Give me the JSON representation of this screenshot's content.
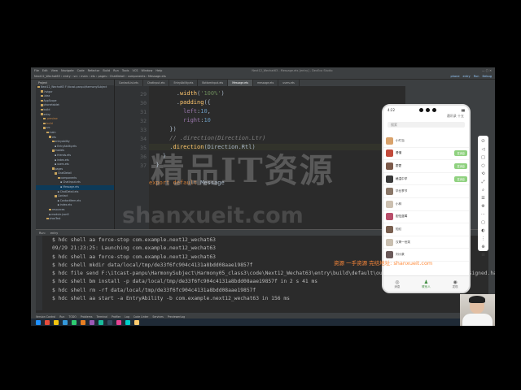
{
  "window": {
    "title": "Next12_Wechat63 - Message.ets [entry] - DevEco Studio",
    "menu": [
      "File",
      "Edit",
      "View",
      "Navigate",
      "Code",
      "Refactor",
      "Build",
      "Run",
      "Tools",
      "VCS",
      "Window",
      "Help"
    ],
    "breadcrumb": [
      "Next12_Wechat63",
      "entry",
      "src",
      "main",
      "ets",
      "pages",
      "ChatDetail",
      "components",
      "Message.ets"
    ],
    "top_right": [
      "phone",
      "entry",
      "Run",
      "Debug"
    ]
  },
  "project_panel": {
    "header": "Project",
    "items": [
      {
        "label": "Next12_Wechat63 F:\\itcast-panpu\\HarmonySubject",
        "folder": true
      },
      {
        "label": ".hvigor",
        "folder": true
      },
      {
        "label": ".idea",
        "folder": true
      },
      {
        "label": "AppScope",
        "folder": true
      },
      {
        "label": "phonetablet",
        "folder": true
      },
      {
        "label": "build",
        "folder": true
      },
      {
        "label": "entry",
        "folder": true
      },
      {
        "label": ".preview",
        "folder": true
      },
      {
        "label": "build",
        "folder": true
      },
      {
        "label": "src",
        "folder": true
      },
      {
        "label": "main",
        "folder": true
      },
      {
        "label": "ets",
        "folder": true
      },
      {
        "label": "entryability",
        "folder": true
      },
      {
        "label": "EntryAbility.ets",
        "folder": false
      },
      {
        "label": "models",
        "folder": true
      },
      {
        "label": "friends.ets",
        "folder": false
      },
      {
        "label": "index.ets",
        "folder": false
      },
      {
        "label": "users.ets",
        "folder": false
      },
      {
        "label": "pages",
        "folder": true
      },
      {
        "label": "ChatDetail",
        "folder": true
      },
      {
        "label": "components",
        "folder": true
      },
      {
        "label": "ChatInput.ets",
        "folder": false
      },
      {
        "label": "Message.ets",
        "folder": false,
        "selected": true
      },
      {
        "label": "ChatDetail.ets",
        "folder": false
      },
      {
        "label": "Contact",
        "folder": true
      },
      {
        "label": "ContactItem.ets",
        "folder": false
      },
      {
        "label": "index.ets",
        "folder": false
      },
      {
        "label": "resources",
        "folder": true
      },
      {
        "label": "module.json5",
        "folder": false
      },
      {
        "label": "ohosTest",
        "folder": true
      }
    ]
  },
  "editor": {
    "tabs": [
      {
        "label": "ContactList.ets",
        "active": false
      },
      {
        "label": "ChatInput.ets",
        "active": false
      },
      {
        "label": "EntryAbility.ets",
        "active": false
      },
      {
        "label": "BottomInput.ets",
        "active": false
      },
      {
        "label": "Message.ets",
        "active": true
      },
      {
        "label": "message.ets",
        "active": false
      },
      {
        "label": "users.ets",
        "active": false
      }
    ],
    "line_numbers": [
      "29",
      "30",
      "31",
      "32",
      "33",
      "34",
      "35",
      "36",
      "37"
    ],
    "code_lines": [
      [
        {
          "t": "        .",
          "c": ""
        },
        {
          "t": "width",
          "c": "fn"
        },
        {
          "t": "(",
          "c": ""
        },
        {
          "t": "'100%'",
          "c": "str"
        },
        {
          "t": ")",
          "c": ""
        }
      ],
      [
        {
          "t": "        .",
          "c": ""
        },
        {
          "t": "padding",
          "c": "fn"
        },
        {
          "t": "({",
          "c": ""
        }
      ],
      [
        {
          "t": "          ",
          "c": ""
        },
        {
          "t": "left",
          "c": "prop"
        },
        {
          "t": ":",
          "c": ""
        },
        {
          "t": "10",
          "c": "num"
        },
        {
          "t": ",",
          "c": ""
        }
      ],
      [
        {
          "t": "          ",
          "c": ""
        },
        {
          "t": "right",
          "c": "prop"
        },
        {
          "t": ":",
          "c": ""
        },
        {
          "t": "10",
          "c": "num"
        }
      ],
      [
        {
          "t": "      })",
          "c": ""
        }
      ],
      [
        {
          "t": "      // .direction(Direction.Ltr)",
          "c": "cmt"
        }
      ],
      [
        {
          "t": "      .",
          "c": ""
        },
        {
          "t": "direction",
          "c": "fn"
        },
        {
          "t": "(Direction.Rtl)",
          "c": ""
        }
      ],
      [
        {
          "t": "    }",
          "c": ""
        }
      ],
      [
        {
          "t": "  }",
          "c": ""
        }
      ],
      [
        {
          "t": "",
          "c": ""
        }
      ],
      [
        {
          "t": "export default ",
          "c": "kw"
        },
        {
          "t": "Message",
          "c": ""
        }
      ]
    ],
    "structure_crumbs": [
      "Message",
      "build()",
      "Row",
      "direction()",
      "Ttl"
    ]
  },
  "console": {
    "tabs": [
      "Run:",
      "entry"
    ],
    "lines": [
      "$ hdc shell aa force-stop com.example.next12_wechat63",
      "09/29 21:23:25: Launching com.example.next12_wechat63",
      "$ hdc shell aa force-stop com.example.next12_wechat63",
      "$ hdc shell mkdir data/local/tmp/de33f6fc904c4131a8bdd08aae19857f",
      "$ hdc file send F:\\itcast-panpu\\HarmonySubject\\Harmony05_class3\\code\\Next12_Wechat63\\entry\\build\\default\\outputs\\default\\entry-default-signed.hap \"data/local/tmp/de33f6fc904c4131a8bdd08aae19857f\"",
      "$ hdc shell bm install -p data/local/tmp/de33f6fc904c4131a8bdd08aae19857f   in 2 s 41 ms",
      "$ hdc shell rm -rf data/local/tmp/de33f6fc904c4131a8bdd08aae19857f",
      "$ hdc shell aa start -a EntryAbility -b com.example.next12_wechat63 in 156 ms"
    ]
  },
  "bottom_tools": [
    "Version Control",
    "Run",
    "TODO",
    "Problems",
    "Terminal",
    "Profiler",
    "Log",
    "Code Linter",
    "Services",
    "PreviewerLog"
  ],
  "status": "App launch: errors failed to install bundle(ErrorCode:...) (a minute ago)",
  "phone": {
    "time": "4:22",
    "header": "通讯录 十五",
    "search_placeholder": "搜索",
    "contacts": [
      {
        "name": "小叮当",
        "button": "",
        "color": "#d9a26b"
      },
      {
        "name": "看懂",
        "button": "发消息",
        "color": "#c24a3a"
      },
      {
        "name": "霍霍",
        "button": "发消息",
        "color": "#7c5a4a"
      },
      {
        "name": "格温中学",
        "button": "发消息",
        "color": "#3a3a3a"
      },
      {
        "name": "毕业季节",
        "button": "",
        "color": "#8a7768"
      },
      {
        "name": "小林",
        "button": "",
        "color": "#ccc0b0"
      },
      {
        "name": "胆怯蓝莓",
        "button": "",
        "color": "#b84e6a"
      },
      {
        "name": "知幻",
        "button": "",
        "color": "#7a6050"
      },
      {
        "name": "汉哥一世笑",
        "button": "",
        "color": "#c9bfb0"
      },
      {
        "name": "刘小泉",
        "button": "",
        "color": "#6a5a5a"
      }
    ],
    "tabs": [
      {
        "label": "消息",
        "icon": "◎",
        "active": false
      },
      {
        "label": "联系人",
        "icon": "♟",
        "active": true
      },
      {
        "label": "发现",
        "icon": "◉",
        "active": false
      }
    ]
  },
  "emulator_tools": [
    "⏻",
    "◁",
    "□",
    "○",
    "⟲",
    "⤢",
    "⌕",
    "☰",
    "⚙",
    "⋯",
    "▢",
    "◐",
    "⋮",
    "⊕",
    "⊞"
  ],
  "taskbar": {
    "time": "21:23",
    "apps": [
      "#1e90ff",
      "#e74c3c",
      "#f1c40f",
      "#3498db",
      "#2ecc71",
      "#e67e22",
      "#9b59b6",
      "#1abc9c",
      "#34495e",
      "#e84393",
      "#00cec9",
      "#fdcb6e"
    ]
  },
  "watermark": {
    "line1": "精品IT资源",
    "line2": "shanxueit.com",
    "line3": "资源 一手资源 完结地址: shanxueit.com"
  }
}
